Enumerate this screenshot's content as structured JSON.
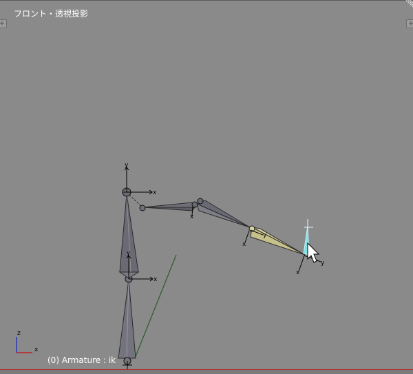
{
  "viewport": {
    "view_label": "フロント・透視投影",
    "status_label": "(0) Armature : ik",
    "background_color": "#8a8a8a"
  },
  "axes_widget": {
    "z_label": "z",
    "x_label": "x",
    "z_color": "#2a38b8",
    "x_color": "#c02020"
  },
  "bone_axis_labels": {
    "x": "x",
    "y": "y"
  },
  "icons": {
    "left_tab": "plus-icon",
    "right_tab": "plus-icon",
    "cursor": "mouse-pointer-icon",
    "corner": "area-split-grip-icon"
  },
  "colors": {
    "bone_fill": "#6e6e78",
    "bone_selected_fill": "#d8d2a0",
    "ik_target": "#80e0e8",
    "ik_line": "#2c5a2c"
  }
}
